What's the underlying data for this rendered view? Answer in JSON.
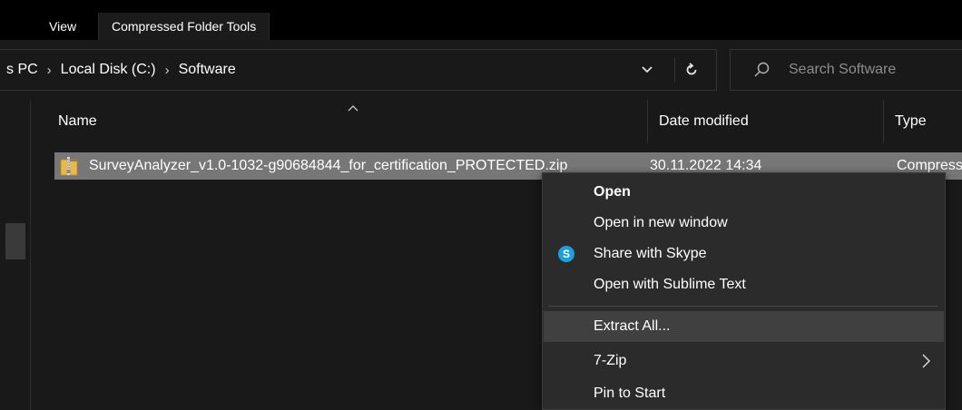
{
  "ribbon": {
    "tabs": [
      "View",
      "Compressed Folder Tools"
    ]
  },
  "address": {
    "crumbs": [
      "s PC",
      "Local Disk (C:)",
      "Software"
    ],
    "separator": "›"
  },
  "search": {
    "placeholder": "Search Software",
    "icon": "search-icon"
  },
  "columns": {
    "name": "Name",
    "date": "Date modified",
    "type": "Type"
  },
  "file": {
    "name": "SurveyAnalyzer_v1.0-1032-g90684844_for_certification_PROTECTED.zip",
    "date": "30.11.2022 14:34",
    "type": "Compressed",
    "icon": "zip-folder-icon"
  },
  "context_menu": {
    "items": [
      {
        "label": "Open",
        "bold": true
      },
      {
        "label": "Open in new window"
      },
      {
        "label": "Share with Skype",
        "icon": "skype-icon",
        "icon_glyph": "S"
      },
      {
        "label": "Open with Sublime Text"
      },
      {
        "label": "Extract All...",
        "hover": true
      },
      {
        "label": "7-Zip",
        "submenu": true
      },
      {
        "label": "Pin to Start"
      }
    ]
  },
  "colors": {
    "background": "#191919",
    "ribbon": "#000000",
    "selected_row": "#777777",
    "menu": "#2b2b2b",
    "menu_hover": "#404040",
    "skype": "#1c9fdd"
  }
}
